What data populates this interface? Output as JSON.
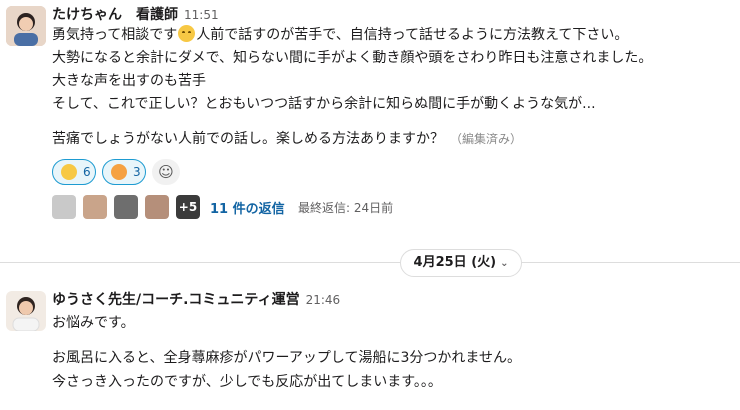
{
  "message1": {
    "sender": "たけちゃん　看護師",
    "time": "11:51",
    "line1_pre": "勇気持って相談です",
    "line1_post": "人前で話すのが苦手で、自信持って話せるように方法教えて下さい。",
    "line2": "大勢になると余計にダメで、知らない間に手がよく動き顔や頭をさわり昨日も注意されました。",
    "line3": "大きな声を出すのも苦手",
    "line4": "そして、これで正しい？とおもいつつ話すから余計に知らぬ間に手が動くような気が...",
    "line5": "苦痛でしょうがない人前での話し。楽しめる方法ありますか？",
    "edited": "（編集済み）",
    "inline_emoji_icon": "grinning-sweat-emoji",
    "reactions": [
      {
        "icon": "grinning-face-emoji",
        "count": "6",
        "color": "#f7c844"
      },
      {
        "icon": "smiling-hearts-emoji",
        "count": "3",
        "color": "#f5a142"
      }
    ],
    "thread": {
      "more_count": "+5",
      "replies_label": "11 件の返信",
      "last_reply": "最終返信: 24日前"
    }
  },
  "date_divider": {
    "label": "4月25日 (火)"
  },
  "message2": {
    "sender": "ゆうさく先生/コーチ.コミュニティ運営",
    "time": "21:46",
    "line1": "お悩みです。",
    "line2": "お風呂に入ると、全身蕁麻疹がパワーアップして湯船に3分つかれません。",
    "line3": "今さっき入ったのですが、少しでも反応が出てしまいます。。。"
  }
}
